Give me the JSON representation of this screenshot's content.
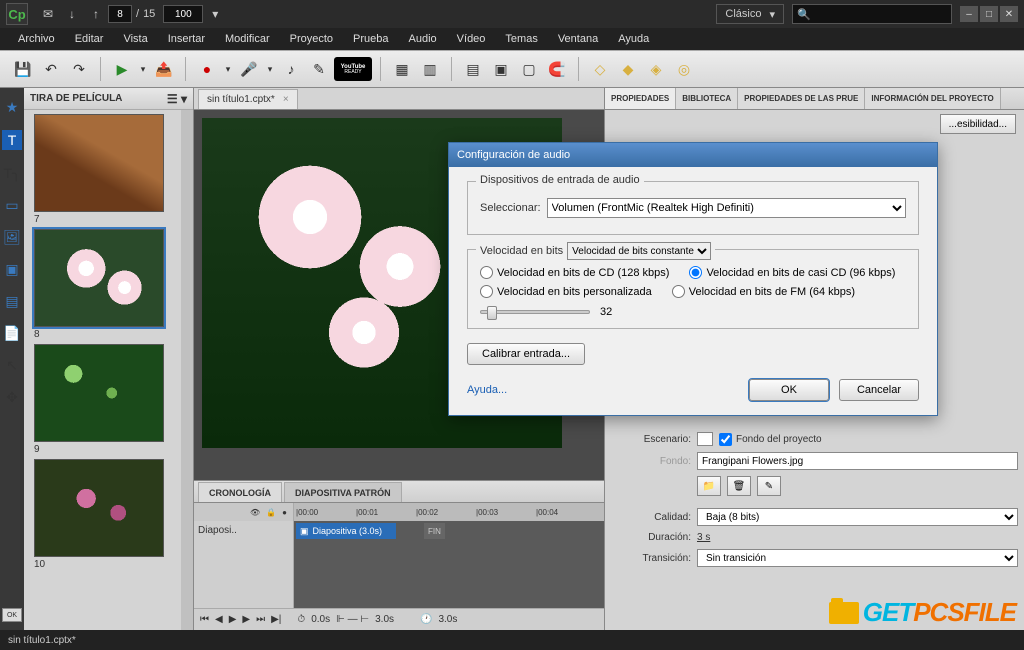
{
  "logo": "Cp",
  "topbar": {
    "page_current": "8",
    "page_sep": "/",
    "page_total": "15",
    "zoom": "100"
  },
  "workspace": {
    "label": "Clásico",
    "caret": "▾"
  },
  "window_buttons": {
    "min": "‒",
    "max": "□",
    "close": "✕"
  },
  "menu": [
    "Archivo",
    "Editar",
    "Vista",
    "Insertar",
    "Modificar",
    "Proyecto",
    "Prueba",
    "Audio",
    "Vídeo",
    "Temas",
    "Ventana",
    "Ayuda"
  ],
  "toolbar_icons": {
    "save": "💾",
    "undo": "↶",
    "redo": "↷",
    "play": "▶",
    "share": "📤",
    "record": "●",
    "rec_caret": "▾",
    "mic": "🎤",
    "mic_caret": "▾",
    "note": "♪",
    "caption": "✎",
    "youtube_top": "YouTube",
    "youtube_bot": "READY",
    "slides1": "▦",
    "slides2": "▥",
    "grid": "▤",
    "layout1": "▣",
    "layout2": "▢",
    "magnet": "🧲",
    "layer1": "◇",
    "layer2": "◆",
    "layer3": "◈",
    "layer4": "◎"
  },
  "filmstrip": {
    "title": "TIRA DE PELÍCULA",
    "menu": "☰ ▾",
    "thumbs": [
      {
        "n": "7"
      },
      {
        "n": "8"
      },
      {
        "n": "9"
      },
      {
        "n": "10"
      }
    ]
  },
  "left_tools": [
    "★",
    "T",
    "T╮",
    "▭",
    "🖼",
    "▣",
    "▤",
    "📄",
    "↖",
    "✥"
  ],
  "left_ok": "OK",
  "doc_tab": {
    "name": "sin título1.cptx*",
    "close": "×"
  },
  "timeline": {
    "tabs": [
      "CRONOLOGÍA",
      "DIAPOSITIVA PATRÓN"
    ],
    "head_icons": [
      "👁",
      "🔒",
      "●"
    ],
    "ruler": [
      "|00:00",
      "|00:01",
      "|00:02",
      "|00:03",
      "|00:04"
    ],
    "track_label": "Diaposi..",
    "clip": "Diapositiva (3.0s)",
    "fin": "FIN",
    "ctrl": {
      "rewind": "⏮",
      "prev": "◀",
      "play": "▶",
      "next": "▶",
      "end": "⏭",
      "last": "▶|",
      "t1": "0.0s",
      "sep1": "⊩ — ⊢",
      "t2": "3.0s",
      "sep2": "🕐",
      "t3": "3.0s"
    }
  },
  "right": {
    "tabs": [
      "PROPIEDADES",
      "BIBLIOTECA",
      "PROPIEDADES DE LAS PRUE",
      "INFORMACIÓN DEL PROYECTO"
    ],
    "acces": "...esibilidad...",
    "escenario": {
      "label": "Escenario:",
      "swatch": "▇",
      "cb": "Fondo del proyecto"
    },
    "fondo": {
      "label": "Fondo:",
      "value": "Frangipani Flowers.jpg"
    },
    "iconbtns": [
      "📁",
      "🗑",
      "✎"
    ],
    "calidad": {
      "label": "Calidad:",
      "value": "Baja (8 bits)"
    },
    "duracion": {
      "label": "Duración:",
      "value": "3 s"
    },
    "transicion": {
      "label": "Transición:",
      "value": "Sin transición"
    }
  },
  "dialog": {
    "title": "Configuración de audio",
    "fs1": {
      "legend": "Dispositivos de entrada de audio",
      "label": "Seleccionar:",
      "value": "Volumen (FrontMic (Realtek High Definiti)"
    },
    "fs2": {
      "legend": "Velocidad en bits",
      "combo": "Velocidad de bits constante",
      "r1": "Velocidad en bits de CD (128 kbps)",
      "r2": "Velocidad en bits de casi CD (96 kbps)",
      "r3": "Velocidad en bits personalizada",
      "r4": "Velocidad en bits de FM (64 kbps)",
      "slider_val": "32"
    },
    "calibrate": "Calibrar entrada...",
    "help": "Ayuda...",
    "ok": "OK",
    "cancel": "Cancelar"
  },
  "status": "sin título1.cptx*",
  "watermark": {
    "t1": "GET",
    "t2": "PCSFILE"
  }
}
